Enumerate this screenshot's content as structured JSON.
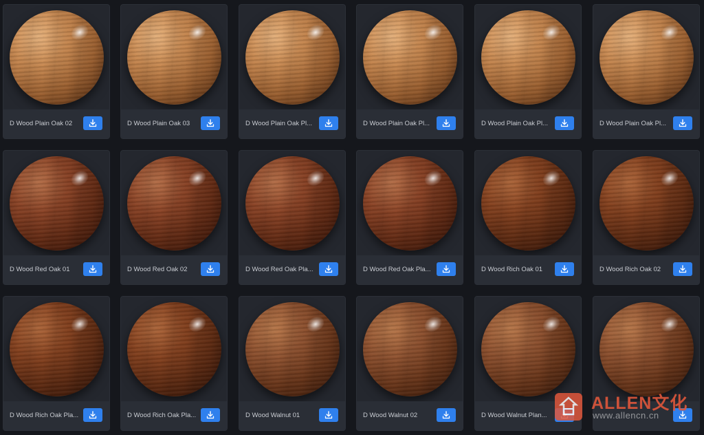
{
  "colors": {
    "background": "#15171c",
    "card": "#22252c",
    "footer": "#2a2e36",
    "button": "#2f80ed",
    "text": "#c9ccd2"
  },
  "materials": [
    {
      "name": "D Wood Plain Oak 02",
      "tone": "light-oak",
      "action_icon": "download-icon"
    },
    {
      "name": "D Wood Plain Oak 03",
      "tone": "light-oak",
      "action_icon": "download-icon"
    },
    {
      "name": "D Wood Plain Oak Pl...",
      "tone": "light-oak",
      "action_icon": "download-icon"
    },
    {
      "name": "D Wood Plain Oak Pl...",
      "tone": "light-oak",
      "action_icon": "download-icon"
    },
    {
      "name": "D Wood Plain Oak Pl...",
      "tone": "light-oak",
      "action_icon": "download-icon"
    },
    {
      "name": "D Wood Plain Oak Pl...",
      "tone": "light-oak",
      "action_icon": "download-icon"
    },
    {
      "name": "D Wood Red Oak 01",
      "tone": "red-oak",
      "action_icon": "download-icon"
    },
    {
      "name": "D Wood Red Oak 02",
      "tone": "red-oak",
      "action_icon": "download-icon"
    },
    {
      "name": "D Wood Red Oak Pla...",
      "tone": "red-oak",
      "action_icon": "download-icon"
    },
    {
      "name": "D Wood Red Oak Pla...",
      "tone": "red-oak",
      "action_icon": "download-icon"
    },
    {
      "name": "D Wood Rich Oak 01",
      "tone": "rich-oak",
      "action_icon": "download-icon"
    },
    {
      "name": "D Wood Rich Oak 02",
      "tone": "rich-oak",
      "action_icon": "download-icon"
    },
    {
      "name": "D Wood Rich Oak Pla...",
      "tone": "rich-oak",
      "action_icon": "download-icon"
    },
    {
      "name": "D Wood Rich Oak Pla...",
      "tone": "rich-oak",
      "action_icon": "download-icon"
    },
    {
      "name": "D Wood Walnut 01",
      "tone": "walnut",
      "action_icon": "download-icon"
    },
    {
      "name": "D Wood Walnut 02",
      "tone": "walnut",
      "action_icon": "download-icon"
    },
    {
      "name": "D Wood Walnut Plan...",
      "tone": "walnut",
      "action_icon": "download-icon"
    },
    {
      "name": "",
      "tone": "walnut",
      "action_icon": "download-icon"
    }
  ],
  "watermark": {
    "brand": "ALLEN文化",
    "url": "www.allencn.cn"
  }
}
